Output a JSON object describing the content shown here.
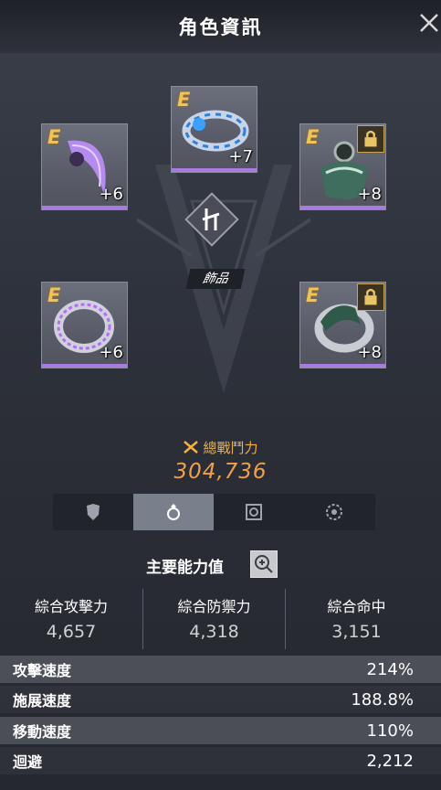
{
  "header": {
    "title": "角色資訊"
  },
  "equipment": {
    "category_label": "飾品",
    "slots": [
      {
        "grade": "E",
        "level": "+6",
        "locked": false,
        "item": "purple-blade-icon"
      },
      {
        "grade": "E",
        "level": "+7",
        "locked": false,
        "item": "blue-bracelet-icon"
      },
      {
        "grade": "E",
        "level": "+8",
        "locked": true,
        "item": "green-amulet-icon"
      },
      {
        "grade": "E",
        "level": "+6",
        "locked": false,
        "item": "purple-ring-icon"
      },
      {
        "grade": "E",
        "level": "+8",
        "locked": true,
        "item": "green-ring-icon"
      }
    ]
  },
  "power": {
    "label": "總戰鬥力",
    "value": "304,736"
  },
  "tabs": [
    {
      "icon": "armor-icon",
      "active": false
    },
    {
      "icon": "ring-icon",
      "active": true
    },
    {
      "icon": "gem-icon",
      "active": false
    },
    {
      "icon": "gear-icon",
      "active": false
    }
  ],
  "stats": {
    "title": "主要能力值",
    "main": [
      {
        "label": "綜合攻擊力",
        "value": "4,657"
      },
      {
        "label": "綜合防禦力",
        "value": "4,318"
      },
      {
        "label": "綜合命中",
        "value": "3,151"
      }
    ],
    "rows": [
      {
        "label": "攻擊速度",
        "value": "214%"
      },
      {
        "label": "施展速度",
        "value": "188.8%"
      },
      {
        "label": "移動速度",
        "value": "110%"
      },
      {
        "label": "迴避",
        "value": "2,212"
      }
    ]
  },
  "colors": {
    "accent_gold": "#f0a04a",
    "grade_bar": "#a77be0",
    "active_tab": "#7a7f8c"
  }
}
